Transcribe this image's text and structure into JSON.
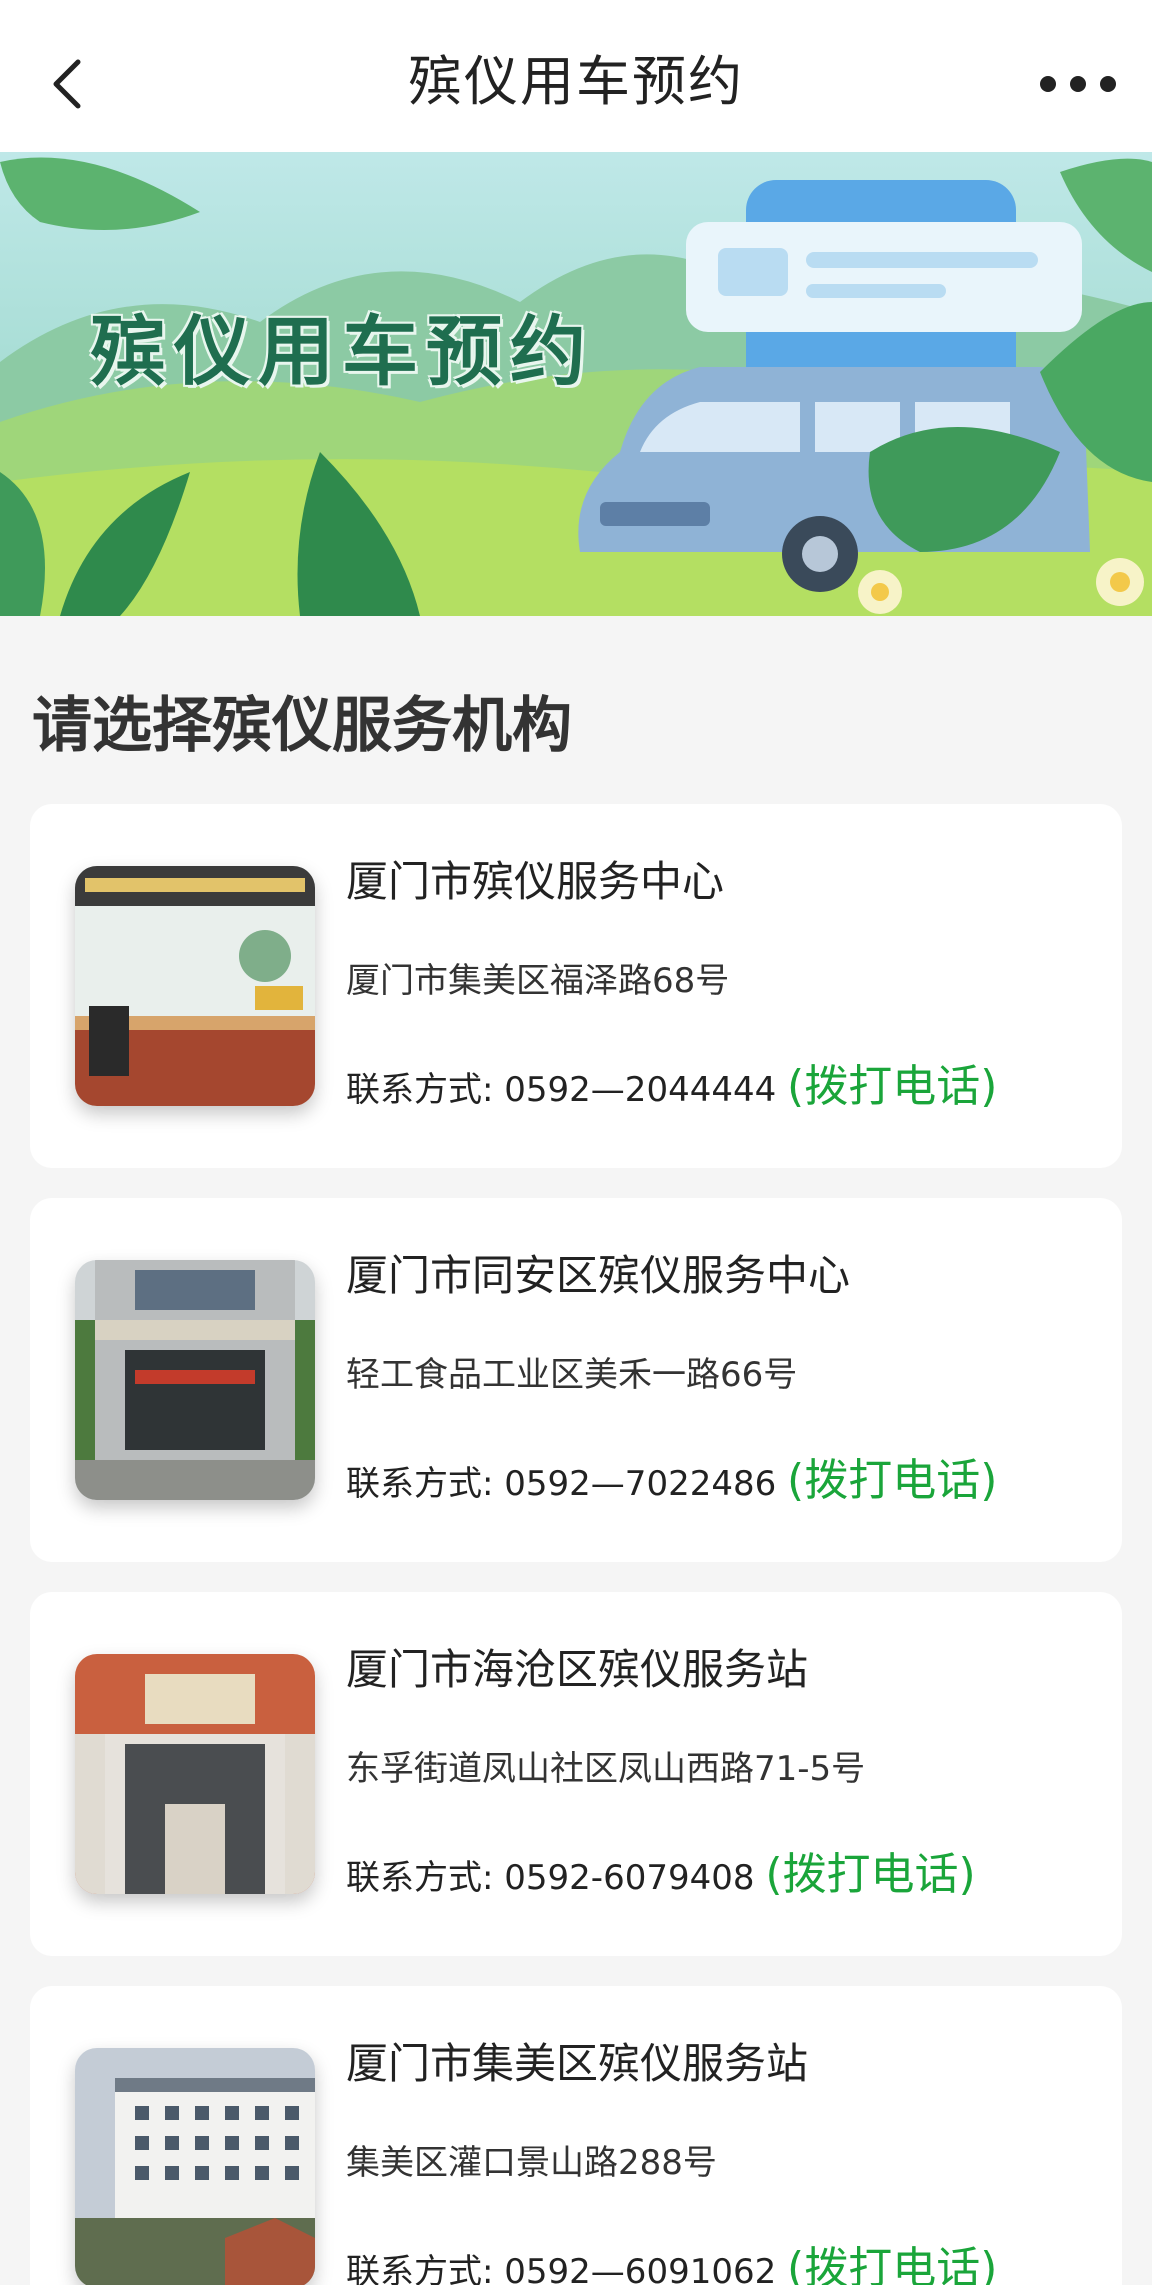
{
  "header": {
    "title": "殡仪用车预约",
    "back_icon": "chevron-left-icon",
    "more_icon": "more-dots-icon"
  },
  "banner": {
    "title": "殡仪用车预约"
  },
  "section": {
    "title": "请选择殡仪服务机构"
  },
  "institutions": [
    {
      "name": "厦门市殡仪服务中心",
      "address": "厦门市集美区福泽路68号",
      "contact_label": "联系方式:",
      "phone": "0592—2044444",
      "call_label": "(拨打电话)"
    },
    {
      "name": "厦门市同安区殡仪服务中心",
      "address": "轻工食品工业区美禾一路66号",
      "contact_label": "联系方式:",
      "phone": "0592—7022486",
      "call_label": "(拨打电话)"
    },
    {
      "name": "厦门市海沧区殡仪服务站",
      "address": "东孚街道凤山社区凤山西路71-5号",
      "contact_label": "联系方式:",
      "phone": "0592-6079408",
      "call_label": "(拨打电话)"
    },
    {
      "name": "厦门市集美区殡仪服务站",
      "address": "集美区灌口景山路288号",
      "contact_label": "联系方式:",
      "phone": "0592—6091062",
      "call_label": "(拨打电话)"
    }
  ],
  "colors": {
    "call_link": "#1aa53a",
    "background": "#f5f5f5"
  }
}
